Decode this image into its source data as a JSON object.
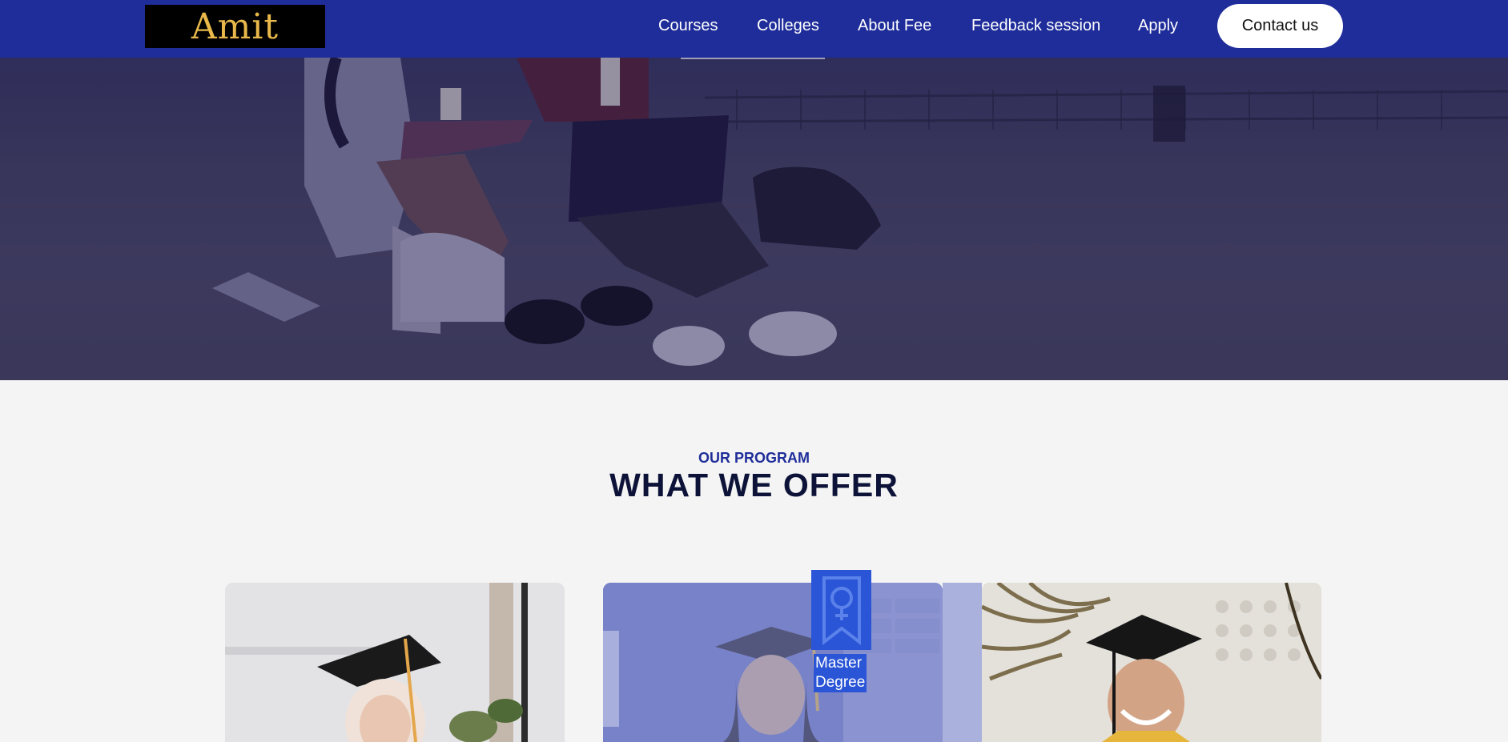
{
  "header": {
    "logo_text": "Amit",
    "nav": [
      "Courses",
      "Colleges",
      "About Fee",
      "Feedback session",
      "Apply"
    ],
    "contact_label": "Contact us",
    "colors": {
      "bar": "#1f2d9a",
      "logo_bg": "#000000",
      "logo_text": "#e8b84a"
    }
  },
  "program": {
    "eyebrow": "OUR PROGRAM",
    "title": "WHAT WE OFFER",
    "badge_icon": "female-award-ribbon-icon",
    "badge_label_line1": "Master",
    "badge_label_line2": "Degree",
    "badge_color": "#2a55d6"
  }
}
